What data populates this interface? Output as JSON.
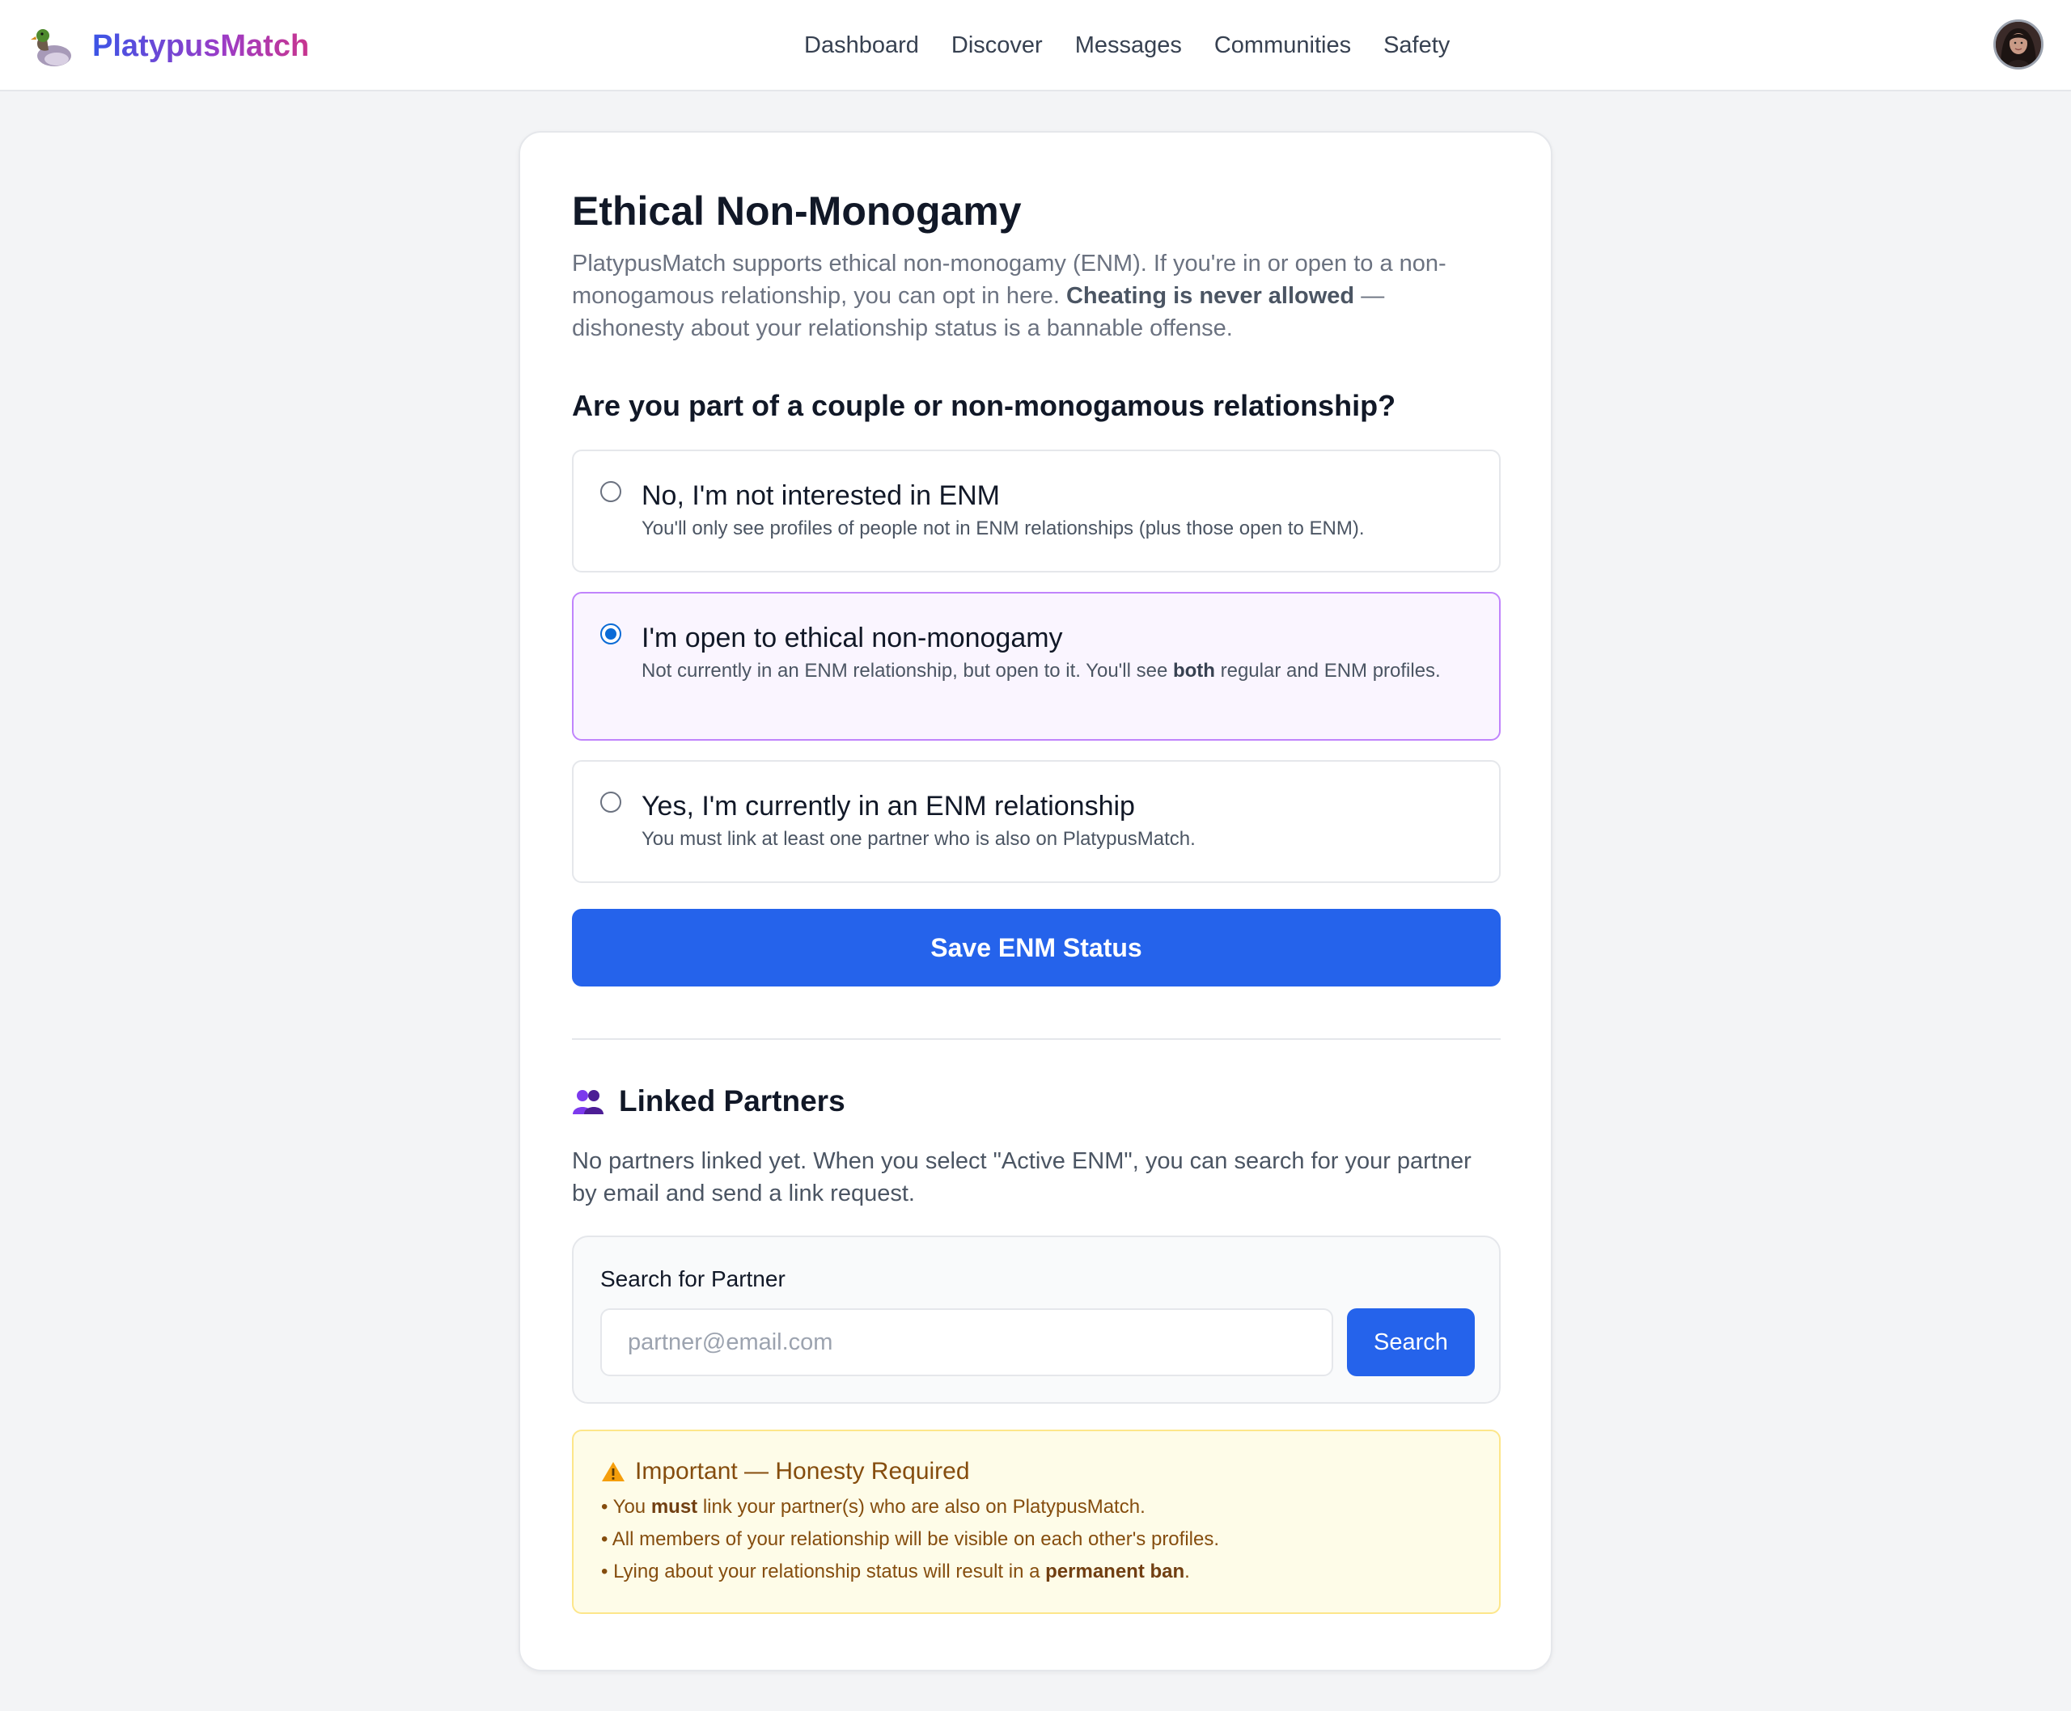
{
  "app": {
    "name": "PlatypusMatch",
    "nav": [
      "Dashboard",
      "Discover",
      "Messages",
      "Communities",
      "Safety"
    ]
  },
  "page": {
    "title": "Ethical Non-Monogamy",
    "intro_1": "PlatypusMatch supports ethical non-monogamy (ENM). If you're in or open to a non-monogamous relationship, you can opt in here. ",
    "intro_bold": "Cheating is never allowed",
    "intro_2": " — dishonesty about your relationship status is a bannable offense.",
    "question": "Are you part of a couple or non-monogamous relationship?"
  },
  "options": [
    {
      "title": "No, I'm not interested in ENM",
      "desc_1": "You'll only see profiles of people not in ENM relationships (plus those open to ENM).",
      "desc_bold": "",
      "desc_2": "",
      "selected": false
    },
    {
      "title": "I'm open to ethical non-monogamy",
      "desc_1": "Not currently in an ENM relationship, but open to it. You'll see ",
      "desc_bold": "both",
      "desc_2": " regular and ENM profiles.",
      "selected": true
    },
    {
      "title": "Yes, I'm currently in an ENM relationship",
      "desc_1": "You must link at least one partner who is also on PlatypusMatch.",
      "desc_bold": "",
      "desc_2": "",
      "selected": false
    }
  ],
  "save_button": "Save ENM Status",
  "partners": {
    "title": "Linked Partners",
    "empty_text": "No partners linked yet. When you select \"Active ENM\", you can search for your partner by email and send a link request.",
    "search_label": "Search for Partner",
    "search_placeholder": "partner@email.com",
    "search_button": "Search"
  },
  "warning": {
    "title": "Important — Honesty Required",
    "items": [
      {
        "pre": "• You ",
        "bold": "must",
        "post": " link your partner(s) who are also on PlatypusMatch."
      },
      {
        "pre": "• All members of your relationship will be visible on each other's profiles.",
        "bold": "",
        "post": ""
      },
      {
        "pre": "• Lying about your relationship status will result in a ",
        "bold": "permanent ban",
        "post": "."
      }
    ]
  },
  "colors": {
    "accent": "#2563eb",
    "selected_border": "#c084fc",
    "selected_bg": "#faf5ff",
    "warning_bg": "#fefce8",
    "warning_text": "#854d0e"
  },
  "icons": {
    "logo": "platypus-duck-logo",
    "partners": "two-people-icon",
    "warning": "warning-triangle-icon"
  }
}
